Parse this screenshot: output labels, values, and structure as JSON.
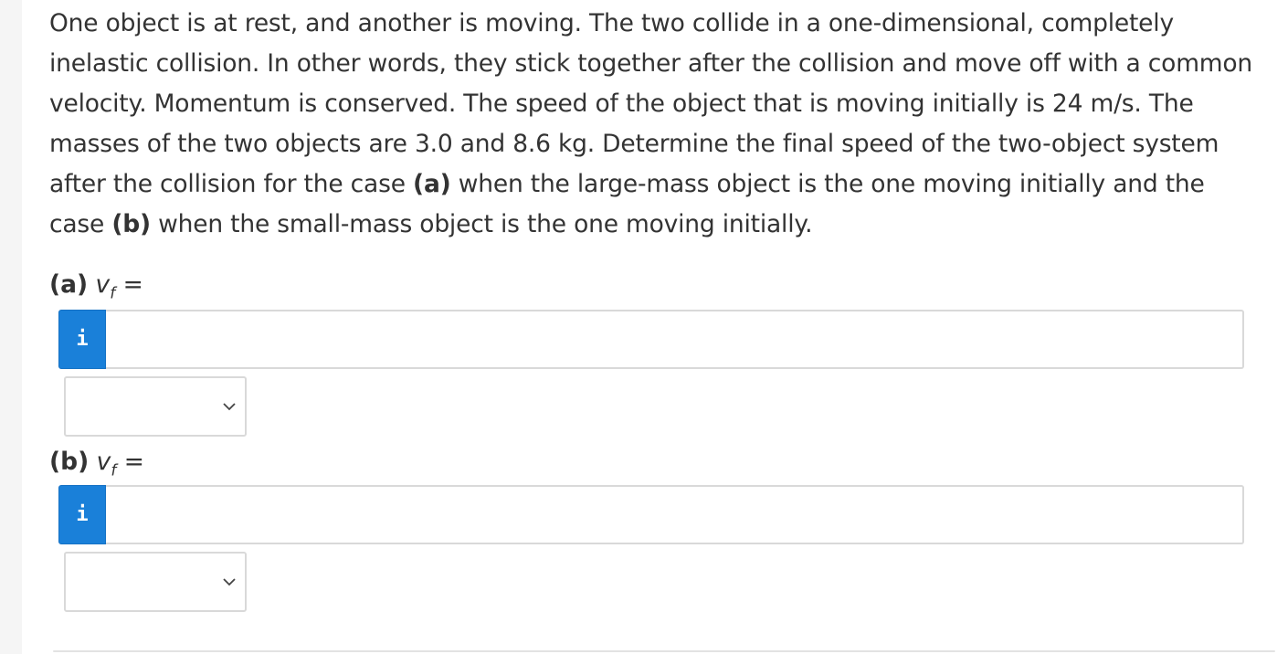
{
  "question": {
    "text_1": "One object is at rest, and another is moving. The two collide in a one-dimensional, completely inelastic collision. In other words, they stick together after the collision and move off with a common velocity. Momentum is conserved. The speed of the object that is moving initially is 24 m/s. The masses of the two objects are 3.0 and 8.6 kg. Determine the final speed of the two-object system after the collision for the case ",
    "bold_a": "(a)",
    "text_2": " when the large-mass object is the one moving initially and the case ",
    "bold_b": "(b)",
    "text_3": " when the small-mass object is the one moving initially."
  },
  "parts": [
    {
      "label": "(a)",
      "variable": "v",
      "subscript": "f",
      "equals": " =",
      "info_glyph": "i",
      "answer_value": "",
      "unit_selected": ""
    },
    {
      "label": "(b)",
      "variable": "v",
      "subscript": "f",
      "equals": " =",
      "info_glyph": "i",
      "answer_value": "",
      "unit_selected": ""
    }
  ]
}
